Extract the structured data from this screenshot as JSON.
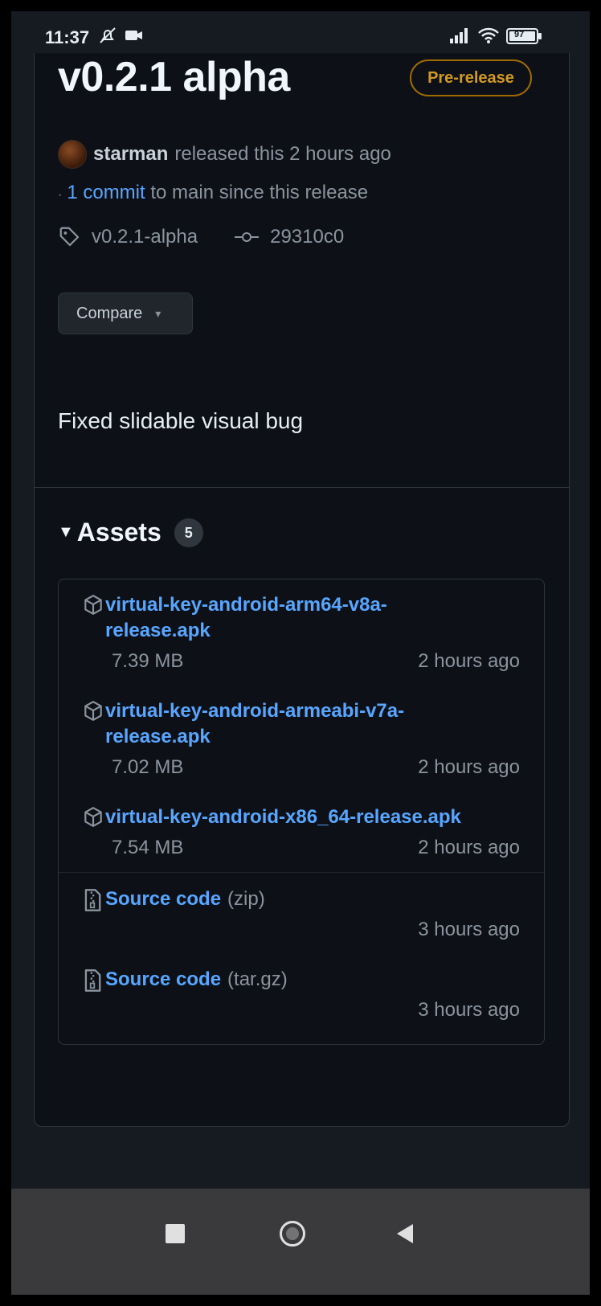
{
  "status_bar": {
    "time": "11:37",
    "battery": "97",
    "icons": [
      "notifications-off-icon",
      "video-icon",
      "signal-icon",
      "wifi-icon",
      "battery-icon"
    ]
  },
  "release": {
    "title": "v0.2.1 alpha",
    "badge": "Pre-release",
    "author": "starman",
    "released_text": "released this 2 hours ago",
    "commits_link": "1 commit",
    "commits_text": "to main since this release",
    "tag": "v0.2.1-alpha",
    "commit_sha": "29310c0",
    "compare_label": "Compare",
    "notes": "Fixed slidable visual bug"
  },
  "assets": {
    "title": "Assets",
    "count": "5",
    "items": [
      {
        "name": "virtual-key-android-arm64-v8a-release.apk",
        "size": "7.39 MB",
        "time": "2 hours ago"
      },
      {
        "name": "virtual-key-android-armeabi-v7a-release.apk",
        "size": "7.02 MB",
        "time": "2 hours ago"
      },
      {
        "name": "virtual-key-android-x86_64-release.apk",
        "size": "7.54 MB",
        "time": "2 hours ago"
      },
      {
        "name": "Source code",
        "suffix": "(zip)",
        "time": "3 hours ago"
      },
      {
        "name": "Source code",
        "suffix": "(tar.gz)",
        "time": "3 hours ago"
      }
    ]
  },
  "colors": {
    "background": "#0d1117",
    "link": "#58a6ff",
    "prerelease": "#d29922",
    "muted": "#8b949e"
  }
}
